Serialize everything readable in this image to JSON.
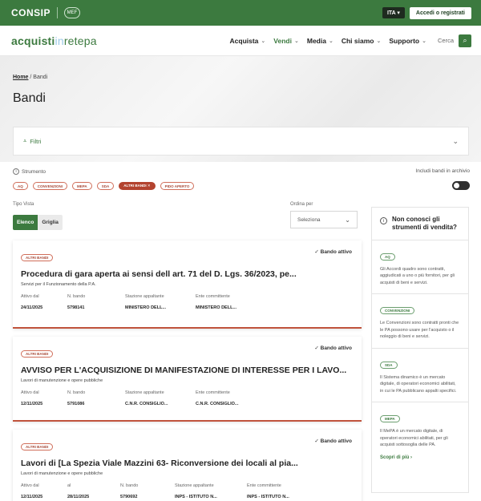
{
  "topbar": {
    "brand": "CONSIP",
    "mef": "MEF",
    "lang": "ITA ▾",
    "login": "Accedi o registrati"
  },
  "nav": {
    "logo_a": "acquisti",
    "logo_b": "in",
    "logo_c": "retepa",
    "items": [
      {
        "label": "Acquista"
      },
      {
        "label": "Vendi"
      },
      {
        "label": "Media"
      },
      {
        "label": "Chi siamo"
      },
      {
        "label": "Supporto"
      }
    ],
    "search_label": "Cerca"
  },
  "breadcrumb": {
    "home": "Home",
    "current": "Bandi"
  },
  "page_title": "Bandi",
  "filters": {
    "label": "Filtri"
  },
  "strumento": {
    "label": "Strumento",
    "archive_label": "Includi bandi in archivio",
    "chips": [
      "AQ",
      "CONVENZIONI",
      "MEPA",
      "SDA",
      "ALTRI BANDI ✕",
      "PIDO APERTO"
    ]
  },
  "view": {
    "label": "Tipo Vista",
    "list": "Elenco",
    "grid": "Griglia"
  },
  "sort": {
    "label": "Ordina per",
    "value": "Seleziona"
  },
  "cards": [
    {
      "chip": "ALTRI BANDI",
      "status": "✓  Bando attivo",
      "title": "Procedura di gara aperta ai sensi dell art. 71 del D. Lgs. 36/2023, pe...",
      "subtitle": "Servizi per il Funzionamento della P.A.",
      "cols": [
        {
          "label": "Attivo dal",
          "value": "24/11/2025"
        },
        {
          "label": "N. bando",
          "value": "5798141"
        },
        {
          "label": "Stazione appaltante",
          "value": "MINISTERO DELL..."
        },
        {
          "label": "Ente committente",
          "value": "MINISTERO DELL..."
        }
      ]
    },
    {
      "chip": "ALTRI BANDI",
      "status": "✓  Bando attivo",
      "title": "AVVISO PER L'ACQUISIZIONE DI MANIFESTAZIONE DI INTERESSE PER I LAVO...",
      "subtitle": "Lavori di manutenzione e opere pubbliche",
      "cols": [
        {
          "label": "Attivo dal",
          "value": "12/11/2025"
        },
        {
          "label": "N. bando",
          "value": "5791086"
        },
        {
          "label": "Stazione appaltante",
          "value": "C.N.R. CONSIGLIO..."
        },
        {
          "label": "Ente committente",
          "value": "C.N.R. CONSIGLIO..."
        }
      ]
    },
    {
      "chip": "ALTRI BANDI",
      "status": "✓  Bando attivo",
      "title": "Lavori di [La Spezia Viale Mazzini 63- Riconversione dei locali al pia...",
      "subtitle": "Lavori di manutenzione e opere pubbliche",
      "cols": [
        {
          "label": "Attivo dal",
          "value": "12/11/2025"
        },
        {
          "label": "al",
          "value": "28/11/2025"
        },
        {
          "label": "N. bando",
          "value": "5790692"
        },
        {
          "label": "Stazione appaltante",
          "value": "INPS - ISTITUTO N..."
        },
        {
          "label": "Ente committente",
          "value": "INPS - ISTITUTO N..."
        }
      ]
    }
  ],
  "sidebar": {
    "title": "Non conosci gli strumenti di vendita?",
    "sections": [
      {
        "chip": "AQ",
        "text": "Gli Accordi quadro sono contratti, aggiudicati a uno o più fornitori, per gli acquisti di beni e servizi."
      },
      {
        "chip": "CONVENZIONI",
        "text": "Le Convenzioni sono contratti pronti che le PA possono usare per l'acquisto o il noleggio di beni e servizi."
      },
      {
        "chip": "SDA",
        "text": "Il Sistema dinamico è un mercato digitale, di operatori economici abilitati, in cui le PA pubblicano appalti specifici."
      },
      {
        "chip": "MEPA",
        "text": "Il MePA è un mercato digitale, di operatori economici abilitati, per gli acquisti sottosoglia delle PA."
      }
    ],
    "link": "Scopri di più  ›"
  },
  "colors": {
    "primary_green": "#3c7a3f",
    "accent_red": "#b3432f"
  }
}
